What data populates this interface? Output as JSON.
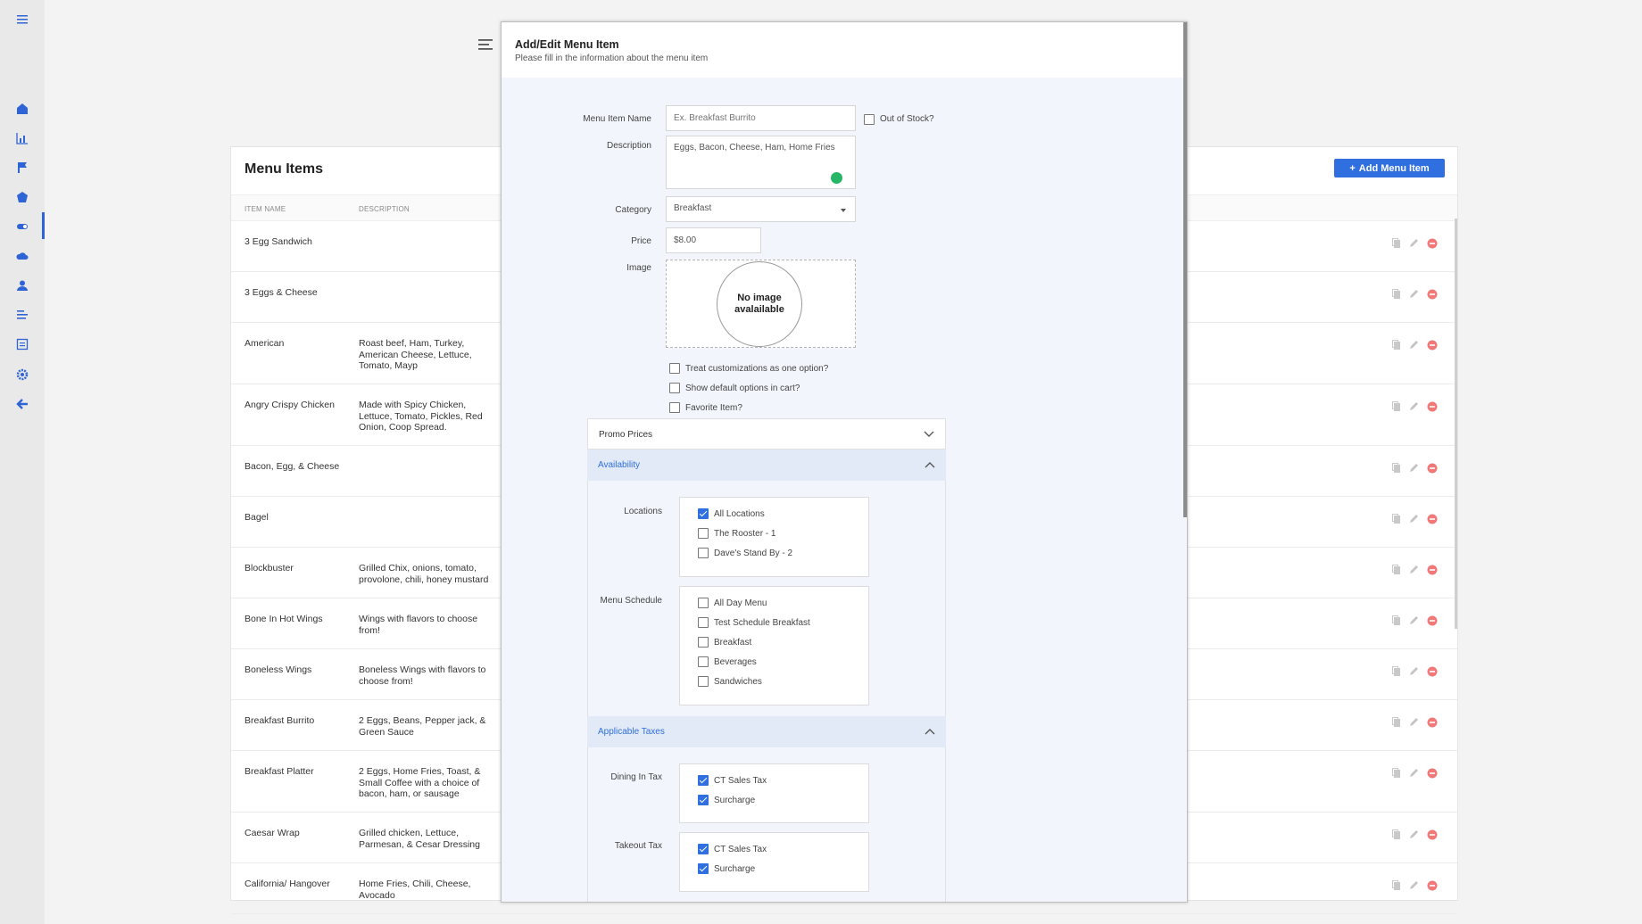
{
  "sidebar": {
    "icons": [
      "hamburger-icon",
      "home-icon",
      "bar-chart-icon",
      "flag-icon",
      "pentagon-icon",
      "toggle-icon",
      "cloud-icon",
      "user-icon",
      "list-icon",
      "form-icon",
      "gear-icon",
      "back-arrow-icon"
    ]
  },
  "menu_items": {
    "title": "Menu Items",
    "add_button": "Add Menu Item",
    "columns": [
      "ITEM NAME",
      "DESCRIPTION"
    ],
    "rows": [
      {
        "name": "3 Egg Sandwich",
        "description": ""
      },
      {
        "name": "3 Eggs & Cheese",
        "description": ""
      },
      {
        "name": "American",
        "description": "Roast beef, Ham, Turkey, American Cheese, Lettuce, Tomato, Mayp"
      },
      {
        "name": "Angry Crispy Chicken",
        "description": "Made with Spicy Chicken, Lettuce, Tomato, Pickles, Red Onion, Coop Spread."
      },
      {
        "name": "Bacon, Egg, & Cheese",
        "description": ""
      },
      {
        "name": "Bagel",
        "description": ""
      },
      {
        "name": "Blockbuster",
        "description": "Grilled Chix, onions, tomato, provolone, chili, honey mustard"
      },
      {
        "name": "Bone In Hot Wings",
        "description": "Wings with flavors to choose from!"
      },
      {
        "name": "Boneless Wings",
        "description": "Boneless Wings with flavors to choose from!"
      },
      {
        "name": "Breakfast Burrito",
        "description": "2 Eggs, Beans, Pepper jack, & Green Sauce"
      },
      {
        "name": "Breakfast Platter",
        "description": "2 Eggs, Home Fries, Toast, & Small Coffee with a choice of bacon, ham, or sausage"
      },
      {
        "name": "Caesar Wrap",
        "description": "Grilled chicken, Lettuce, Parmesan, & Cesar Dressing"
      },
      {
        "name": "California/ Hangover",
        "description": "Home Fries, Chili, Cheese, Avocado"
      }
    ]
  },
  "modal": {
    "title": "Add/Edit Menu Item",
    "subtitle": "Please fill in the information about the menu item",
    "fields": {
      "name_label": "Menu Item Name",
      "name_placeholder": "Ex. Breakfast Burrito",
      "out_of_stock_label": "Out of Stock?",
      "out_of_stock": false,
      "description_label": "Description",
      "description_value": "Eggs, Bacon, Cheese, Ham, Home Fries",
      "category_label": "Category",
      "category_value": "Breakfast",
      "price_label": "Price",
      "price_value": "$8.00",
      "image_label": "Image",
      "no_image_text": "No image avalailable"
    },
    "options": [
      {
        "label": "Treat customizations as one option?",
        "checked": false
      },
      {
        "label": "Show default options in cart?",
        "checked": false
      },
      {
        "label": "Favorite Item?",
        "checked": false
      }
    ],
    "promo_prices": {
      "label": "Promo Prices",
      "expanded": false
    },
    "availability": {
      "label": "Availability",
      "expanded": true,
      "locations_label": "Locations",
      "locations": [
        {
          "label": "All Locations",
          "checked": true
        },
        {
          "label": "The Rooster - 1",
          "checked": false
        },
        {
          "label": "Dave's Stand By - 2",
          "checked": false
        }
      ],
      "schedule_label": "Menu Schedule",
      "schedules": [
        {
          "label": "All Day Menu",
          "checked": false
        },
        {
          "label": "Test Schedule Breakfast",
          "checked": false
        },
        {
          "label": "Breakfast",
          "checked": false
        },
        {
          "label": "Beverages",
          "checked": false
        },
        {
          "label": "Sandwiches",
          "checked": false
        }
      ]
    },
    "taxes": {
      "label": "Applicable Taxes",
      "expanded": true,
      "dining_label": "Dining In Tax",
      "dining": [
        {
          "label": "CT Sales Tax",
          "checked": true
        },
        {
          "label": "Surcharge",
          "checked": true
        }
      ],
      "takeout_label": "Takeout Tax",
      "takeout": [
        {
          "label": "CT Sales Tax",
          "checked": true
        },
        {
          "label": "Surcharge",
          "checked": true
        }
      ]
    }
  },
  "colors": {
    "accent": "#2f6fe0",
    "sidebar_icon": "#2f64d6",
    "delete": "#e85050",
    "availability_header_bg": "#e3eaf7"
  }
}
